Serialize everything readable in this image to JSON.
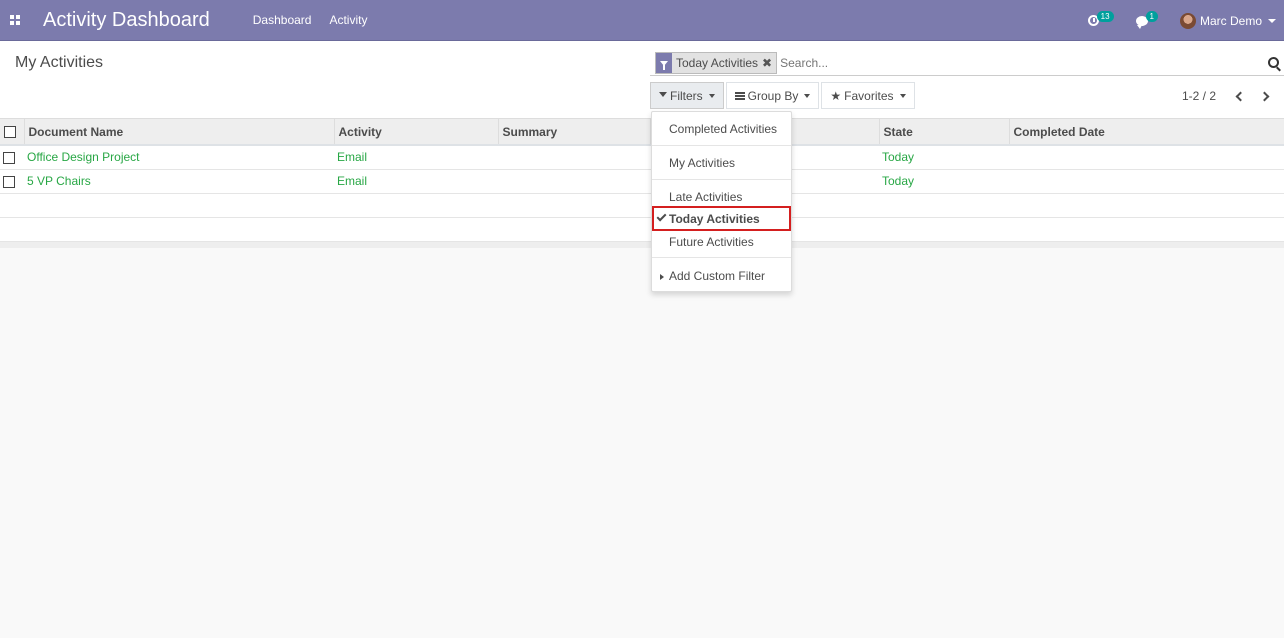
{
  "navbar": {
    "app_title": "Activity Dashboard",
    "menu": [
      "Dashboard",
      "Activity"
    ],
    "activity_badge": "13",
    "message_badge": "1",
    "user_name": "Marc Demo"
  },
  "control_panel": {
    "breadcrumb": "My Activities",
    "facet_label": "Today Activities",
    "facet_remove": "✖",
    "search_placeholder": "Search...",
    "filters_label": "Filters",
    "groupby_label": "Group By",
    "favorites_label": "Favorites",
    "pager_value": "1-2 / 2"
  },
  "table": {
    "columns": [
      "Document Name",
      "Activity",
      "Summary",
      "",
      "State",
      "Completed Date"
    ],
    "rows": [
      {
        "document": "Office Design Project",
        "activity": "Email",
        "summary": "",
        "state": "Today",
        "completed": ""
      },
      {
        "document": "5 VP Chairs",
        "activity": "Email",
        "summary": "",
        "state": "Today",
        "completed": ""
      }
    ]
  },
  "filters_dropdown": {
    "items": [
      "Completed Activities",
      "My Activities",
      "Late Activities",
      "Today Activities",
      "Future Activities",
      "Add Custom Filter"
    ],
    "selected": "Today Activities"
  },
  "colors": {
    "navbar": "#7c7bad",
    "link_green": "#28a745",
    "highlight_border": "#d41f1f",
    "badge": "#00a09d"
  }
}
